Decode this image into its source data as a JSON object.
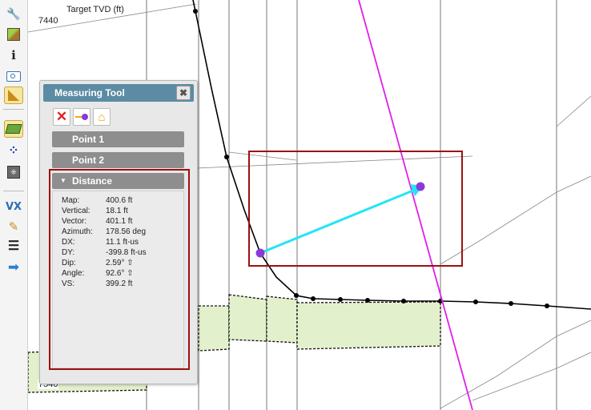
{
  "toolbar": {
    "items": [
      {
        "icon": "wrench-icon",
        "glyph": "🔧",
        "color": "#d93a2b"
      },
      {
        "icon": "cube-icon",
        "glyph": "▣",
        "color": "#7aa83a"
      },
      {
        "icon": "info-icon",
        "glyph": "i",
        "color": "#222222"
      },
      {
        "icon": "camera-icon",
        "glyph": "📷",
        "color": "#3a6fb0"
      },
      {
        "icon": "measure-icon",
        "glyph": "📐",
        "color": "#c98a1a"
      },
      {
        "icon": "surface-icon",
        "glyph": "◩",
        "color": "#5a9a30"
      },
      {
        "icon": "points-icon",
        "glyph": "⁘",
        "color": "#2244cc"
      },
      {
        "icon": "scatter-icon",
        "glyph": "⁜",
        "color": "#555555"
      },
      {
        "icon": "vx-icon",
        "glyph": "VX",
        "color": "#2a6fb5"
      },
      {
        "icon": "pencil-icon",
        "glyph": "✎",
        "color": "#d08a20"
      },
      {
        "icon": "align-icon",
        "glyph": "☰",
        "color": "#222222"
      },
      {
        "icon": "arrow-right-icon",
        "glyph": "➡",
        "color": "#2a7fd4"
      }
    ]
  },
  "plot": {
    "title": "Target TVD (ft)",
    "y_labels": [
      "7440",
      "7540"
    ]
  },
  "measuring_tool": {
    "title": "Measuring Tool",
    "close": "✖",
    "point1": "Point 1",
    "point2": "Point 2",
    "distance": "Distance",
    "rows": [
      {
        "label": "Map:",
        "value": "400.6 ft"
      },
      {
        "label": "Vertical:",
        "value": "18.1 ft"
      },
      {
        "label": "Vector:",
        "value": "401.1 ft"
      },
      {
        "label": "Azimuth:",
        "value": "178.56 deg"
      },
      {
        "label": "DX:",
        "value": "11.1 ft-us"
      },
      {
        "label": "DY:",
        "value": "-399.8 ft-us"
      },
      {
        "label": "Dip:",
        "value": "2.59° ⇧"
      },
      {
        "label": "Angle:",
        "value": "92.6° ⇧"
      },
      {
        "label": "VS:",
        "value": "399.2 ft"
      }
    ]
  },
  "colors": {
    "highlight": "#9b1111",
    "panel_header": "#5b8ca4",
    "measure_arrow": "#22e5f5",
    "trajectory_target": "#e020e8",
    "layer_fill": "#e3f0cc"
  }
}
